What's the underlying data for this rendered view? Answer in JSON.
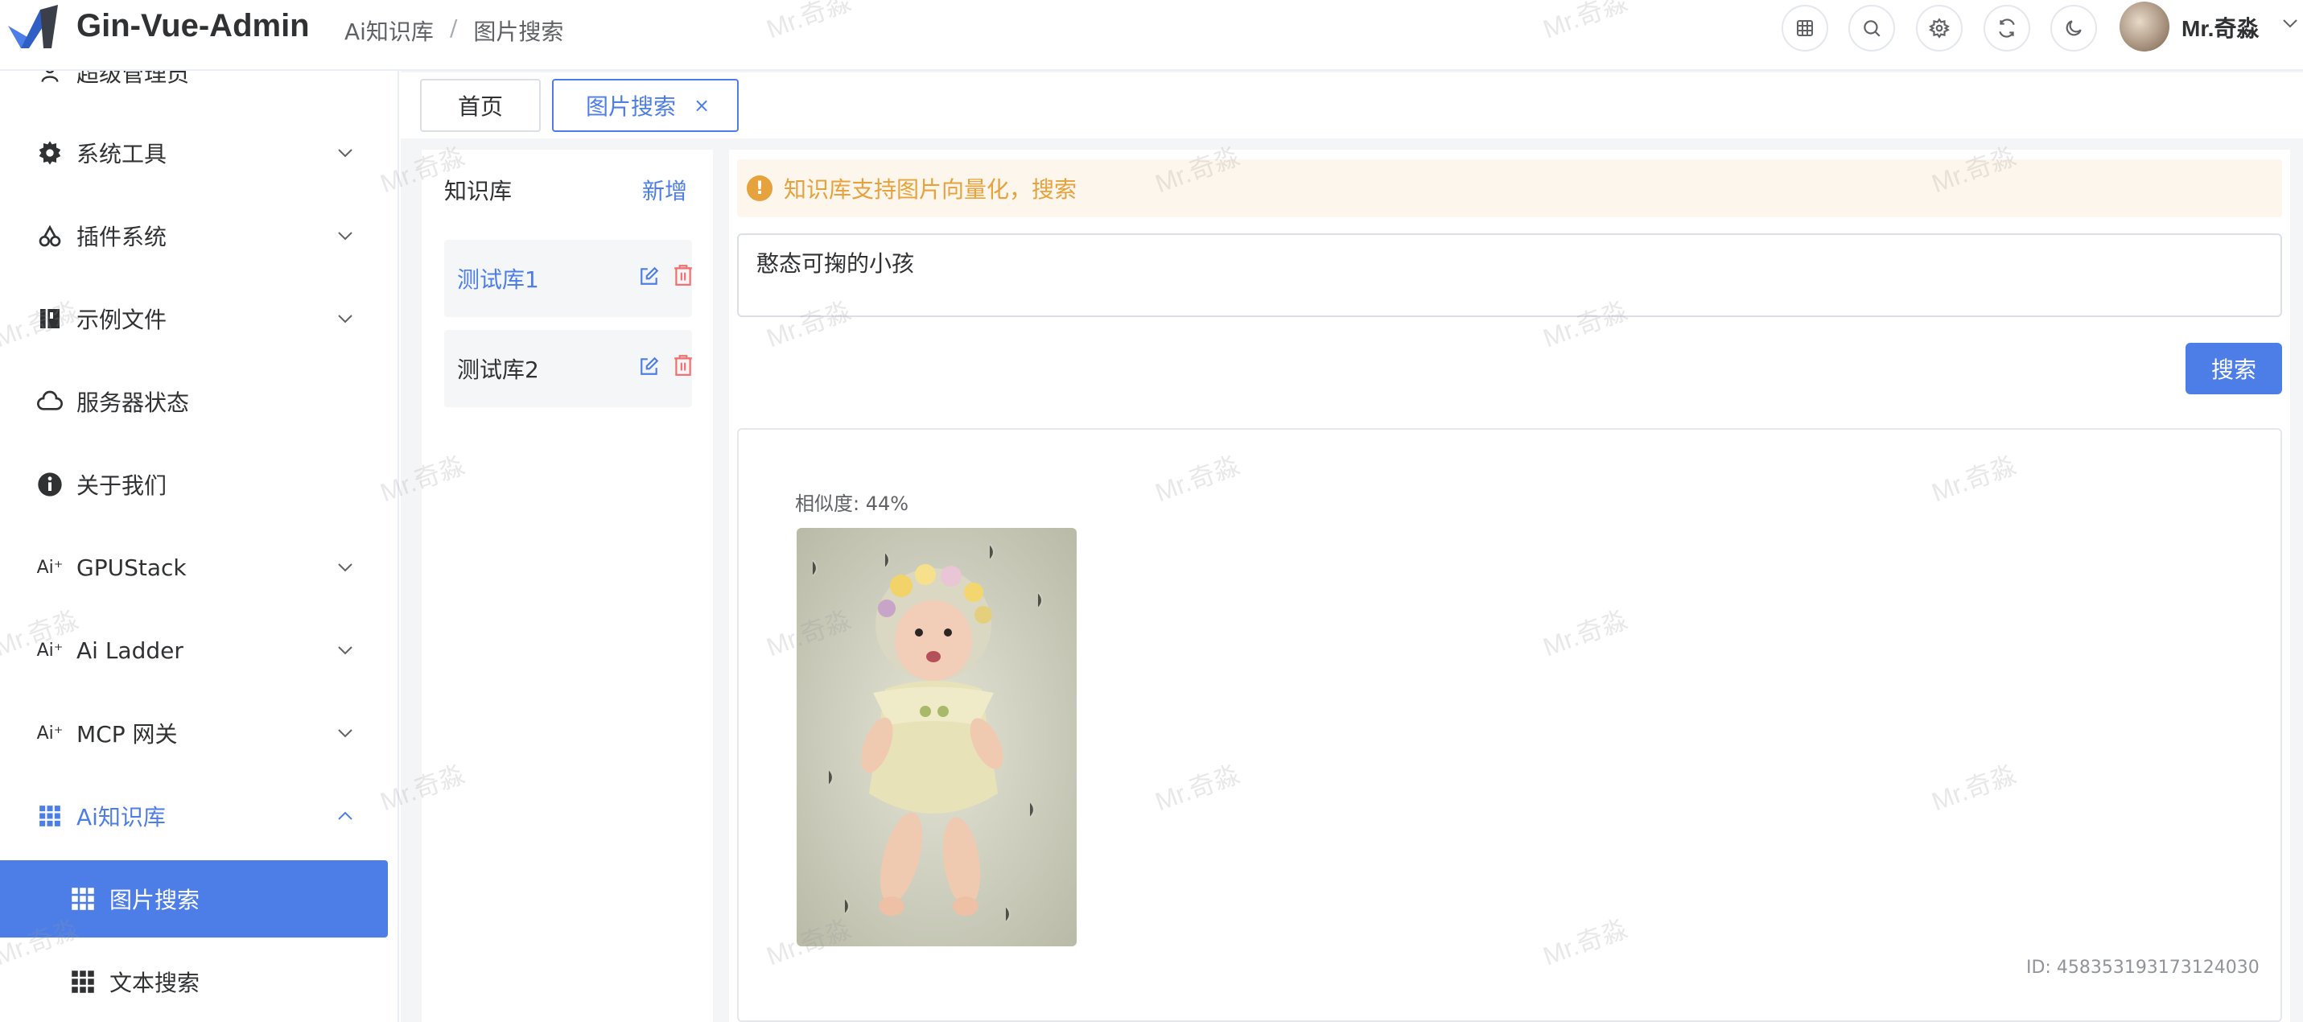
{
  "header": {
    "app_title": "Gin-Vue-Admin",
    "breadcrumb": [
      "Ai知识库",
      "/",
      "图片搜索"
    ],
    "icons": [
      "grid-icon",
      "search-icon",
      "settings-icon",
      "refresh-icon",
      "moon-icon"
    ],
    "username": "Mr.奇淼"
  },
  "sidebar": {
    "partial_item": "超级管理员",
    "items": [
      {
        "label": "系统工具",
        "icon": "gear-icon"
      },
      {
        "label": "插件系统",
        "icon": "cherry-icon"
      },
      {
        "label": "示例文件",
        "icon": "book-icon"
      },
      {
        "label": "服务器状态",
        "icon": "cloud-icon"
      },
      {
        "label": "关于我们",
        "icon": "info-icon"
      },
      {
        "label": "GPUStack",
        "icon": "ai-icon"
      },
      {
        "label": "Ai Ladder",
        "icon": "ai-icon"
      },
      {
        "label": "MCP 网关",
        "icon": "ai-icon"
      },
      {
        "label": "Ai知识库",
        "icon": "grid-icon"
      }
    ],
    "sub_items": [
      {
        "label": "图片搜索",
        "icon": "grid-icon"
      },
      {
        "label": "文本搜索",
        "icon": "grid-icon"
      }
    ]
  },
  "tabs": [
    {
      "label": "首页"
    },
    {
      "label": "图片搜索",
      "close": "×"
    }
  ],
  "knowledge_base": {
    "title": "知识库",
    "add_label": "新增",
    "items": [
      {
        "name": "测试库1"
      },
      {
        "name": "测试库2"
      }
    ]
  },
  "search": {
    "alert_icon": "!",
    "alert": "知识库支持图片向量化，搜索",
    "query": "憨态可掬的小孩",
    "button": "搜索"
  },
  "result": {
    "similarity": "相似度: 44%",
    "id": "ID: 458353193173124030"
  },
  "watermark": "Mr.奇淼",
  "colors": {
    "primary": "#4d7ee8",
    "warning": "#e6a23c",
    "danger": "#f56c6c"
  }
}
